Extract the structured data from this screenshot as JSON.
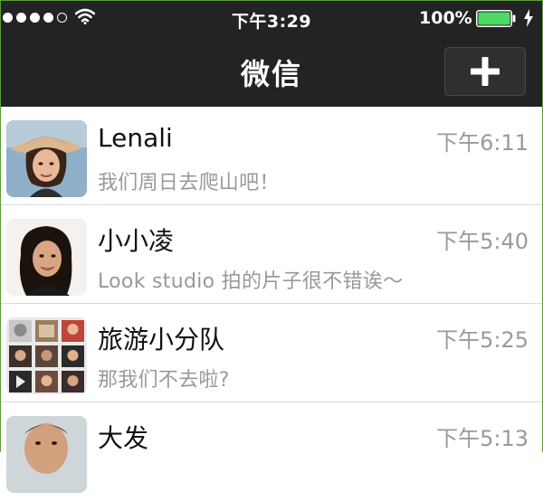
{
  "status_bar": {
    "time": "下午3:29",
    "battery_percent": "100%",
    "signal_strength": 4,
    "battery_level": 1.0,
    "icons": [
      "signal-dots-icon",
      "wifi-icon",
      "battery-icon",
      "charging-bolt-icon"
    ]
  },
  "nav": {
    "title": "微信",
    "add_button_icon": "plus-icon"
  },
  "chats": [
    {
      "name": "Lenali",
      "time": "下午6:11",
      "preview": "我们周日去爬山吧！"
    },
    {
      "name": "小小凌",
      "time": "下午5:40",
      "preview": "Look studio 拍的片子很不错诶～"
    },
    {
      "name": "旅游小分队",
      "time": "下午5:25",
      "preview": "那我们不去啦?"
    },
    {
      "name": "大发",
      "time": "下午5:13",
      "preview": ""
    }
  ],
  "colors": {
    "bar_background": "#232323",
    "battery_green": "#4cd964",
    "time_gray": "#9a9a9a",
    "preview_gray": "#999999"
  }
}
